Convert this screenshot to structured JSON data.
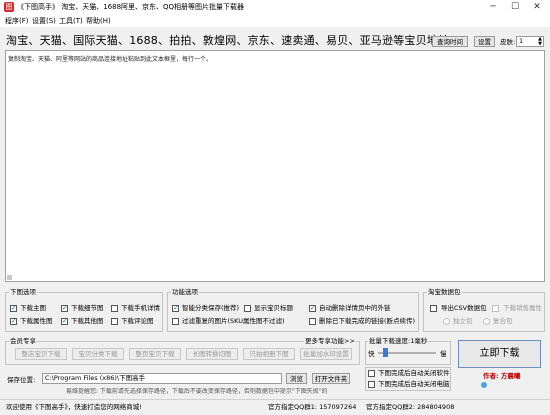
{
  "window": {
    "title": "《下图高手》 淘宝、天猫、1688阿里、京东、QQ相册等图片批量下载器",
    "app_icon": "图"
  },
  "menu": [
    "程序(F)",
    "设置(S)",
    "工具(T)",
    "帮助(H)"
  ],
  "header": {
    "label": "淘宝、天猫、国际天猫、1688、拍拍、敦煌网、京东、速卖通、易贝、亚马逊等宝贝地址:",
    "btn_query_time": "查询时间",
    "btn_settings": "设置",
    "skin_label": "皮肤:",
    "skin_value": "1"
  },
  "textarea": {
    "placeholder": "复制淘宝、天猫、阿里等网站的商品连接地址粘贴到此文本框里，每行一个。"
  },
  "download_options": {
    "title": "下图选项",
    "items": [
      {
        "label": "下载主图",
        "checked": true
      },
      {
        "label": "下载细节图",
        "checked": true
      },
      {
        "label": "下载手机详情",
        "checked": false
      },
      {
        "label": "下载属性图",
        "checked": true
      },
      {
        "label": "下载其他图",
        "checked": true
      },
      {
        "label": "下载评论图",
        "checked": false
      }
    ]
  },
  "function_options": {
    "title": "功能选项",
    "items": [
      {
        "label": "智能分类保存(推荐)",
        "checked": true
      },
      {
        "label": "显示宝贝标题",
        "checked": false
      },
      {
        "label": "自动删除详情页中的外链",
        "checked": true
      },
      {
        "label": "过滤重复的图片(SKU属性图不过滤)",
        "checked": false
      },
      {
        "label": "删除已下载完成的链接(断点续传)",
        "checked": false
      }
    ]
  },
  "taobao_pack": {
    "title": "淘宝数据包",
    "export_csv": "导出CSV数据包",
    "download_attrs": "下载销售属性",
    "radio_single": "独立包",
    "radio_combined": "复合包"
  },
  "member_zone": {
    "title": "会员专享",
    "more": "更多专享功能>>",
    "buttons": [
      "整店宝贝下载",
      "宝贝分类下载",
      "整页宝贝下载",
      "长图转换切图",
      "只拍相册下图",
      "批量加水印设置"
    ]
  },
  "speed": {
    "title": "批量下载速度:",
    "value": "1毫秒",
    "fast": "快",
    "slow": "慢",
    "fill": 0.08,
    "after_close": "下图完成后自动关闭软件",
    "after_shutdown": "下图完成后自动关闭电脑"
  },
  "save": {
    "label": "保存位置:",
    "path": "C:\\Program Files (x86)\\下图高手",
    "btn_browse": "浏览",
    "btn_open": "打开文件夹",
    "tip": "易维提醒您: 下载前请先选择保存路径，下载后不要改变保存路径，否则数据包中提示\"下图失败\"的"
  },
  "start_button": "立即下载",
  "author": "作者: 方晨曦",
  "statusbar": {
    "left": "欢迎使用《下图高手》，快速打造您的网络商城!",
    "qq1": "官方指定QQ群1: 157097264",
    "qq2": "官方指定QQ群2: 284804908"
  },
  "colors": {
    "accent": "#1a6ad1",
    "author": "#c00000",
    "logo": "#d42a2a"
  }
}
